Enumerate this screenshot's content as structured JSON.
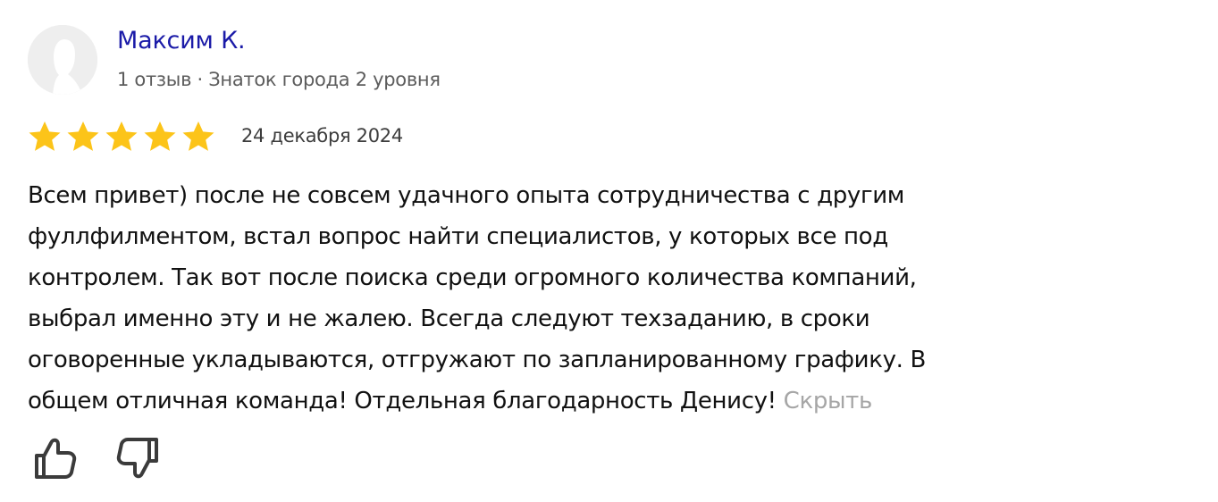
{
  "author": {
    "name": "Максим К.",
    "meta": "1 отзыв · Знаток города 2 уровня"
  },
  "rating": {
    "value": 5,
    "max": 5,
    "star_color": "#fcc419"
  },
  "review": {
    "date": "24 декабря 2024",
    "text_lines": [
      "Всем привет) после не совсем удачного опыта сотрудничества с другим",
      "фуллфилментом, встал вопрос найти специалистов, у которых все под",
      "контролем. Так вот после поиска среди огромного количества компаний,",
      "выбрал именно эту и не жалею. Всегда следуют техзаданию, в сроки",
      "оговоренные укладываются, отгружают по запланированному графику. В",
      "общем отличная команда! Отдельная благодарность Денису!"
    ],
    "hide_label": "Скрыть"
  },
  "reactions": {
    "like_icon": "thumbs-up-icon",
    "dislike_icon": "thumbs-down-icon"
  },
  "colors": {
    "author_name": "#1b1ba8",
    "hide_link": "#a6a6a6"
  }
}
